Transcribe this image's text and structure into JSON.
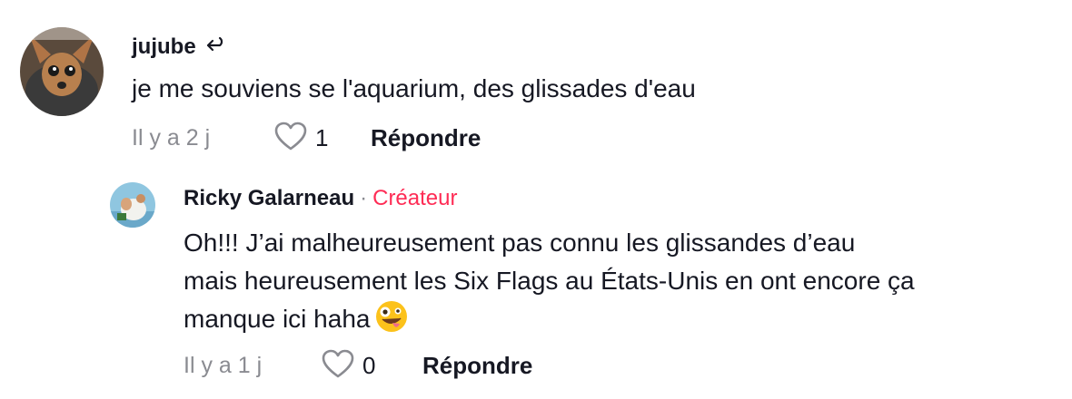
{
  "comments": [
    {
      "username": "jujube",
      "text": "je me souviens se l'aquarium, des glissades d'eau",
      "time": "Il y a 2 j",
      "likes": "1",
      "reply_label": "Répondre"
    }
  ],
  "reply": {
    "username": "Ricky Galarneau",
    "separator": "·",
    "badge": "Créateur",
    "text_lines": [
      "Oh!!! J’ai malheureusement pas connu les glissandes d’eau",
      "mais heureusement les Six Flags au États-Unis en ont encore ça",
      "manque ici haha"
    ],
    "emoji": "zany-face",
    "time": "Il y a 1 j",
    "likes": "0",
    "reply_label": "Répondre",
    "badge_color": "#fe2c55"
  }
}
